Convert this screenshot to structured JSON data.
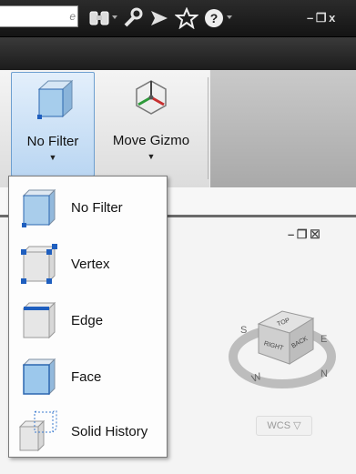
{
  "topbar": {
    "search_placeholder": "e",
    "tools": [
      "binoculars-icon",
      "wrench-icon",
      "send-icon",
      "favorites-star-icon",
      "help-icon"
    ],
    "window_controls": "– ❐ x"
  },
  "ribbon": {
    "no_filter_label": "No Filter",
    "move_gizmo_label": "Move Gizmo",
    "caret": "▼"
  },
  "menu": {
    "items": [
      {
        "label": "No Filter",
        "icon": "no-filter-icon"
      },
      {
        "label": "Vertex",
        "icon": "vertex-icon"
      },
      {
        "label": "Edge",
        "icon": "edge-icon"
      },
      {
        "label": "Face",
        "icon": "face-icon"
      },
      {
        "label": "Solid History",
        "icon": "solid-history-icon"
      }
    ]
  },
  "viewport": {
    "controls": "– ❐ ☒",
    "viewcube": {
      "top": "TOP",
      "front": "RIGHT",
      "side": "BACK"
    },
    "compass": {
      "north": "N",
      "south": "S",
      "east": "E",
      "west": "W"
    },
    "wcs_label": "WCS ▽"
  },
  "colors": {
    "accent_blue": "#1f5fbf",
    "active_bg": "#bad6f2"
  }
}
